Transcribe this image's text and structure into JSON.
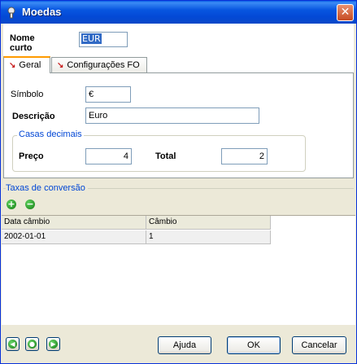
{
  "window": {
    "title": "Moedas",
    "close_glyph": "✕"
  },
  "header": {
    "nome_label": "Nome curto",
    "nome_value": "EUR"
  },
  "tabs": [
    {
      "label": "Geral",
      "active": true
    },
    {
      "label": "Configurações FO",
      "active": false
    }
  ],
  "geral": {
    "simbolo_label": "Símbolo",
    "simbolo_value": "€",
    "descricao_label": "Descrição",
    "descricao_value": "Euro",
    "casas_title": "Casas decimais",
    "preco_label": "Preço",
    "preco_value": "4",
    "total_label": "Total",
    "total_value": "2"
  },
  "taxas": {
    "title": "Taxas de conversão",
    "add_icon": "add-icon",
    "remove_icon": "remove-icon",
    "columns": [
      "Data câmbio",
      "Câmbio"
    ],
    "rows": [
      [
        "2002-01-01",
        "1"
      ]
    ]
  },
  "footer": {
    "ajuda_label": "Ajuda",
    "ok_label": "OK",
    "cancelar_label": "Cancelar"
  },
  "colors": {
    "title_bar": "#0a55e0",
    "group_title": "#0046d5",
    "tab_accent": "#ff9b00",
    "nav_green": "#0f7a0f"
  }
}
